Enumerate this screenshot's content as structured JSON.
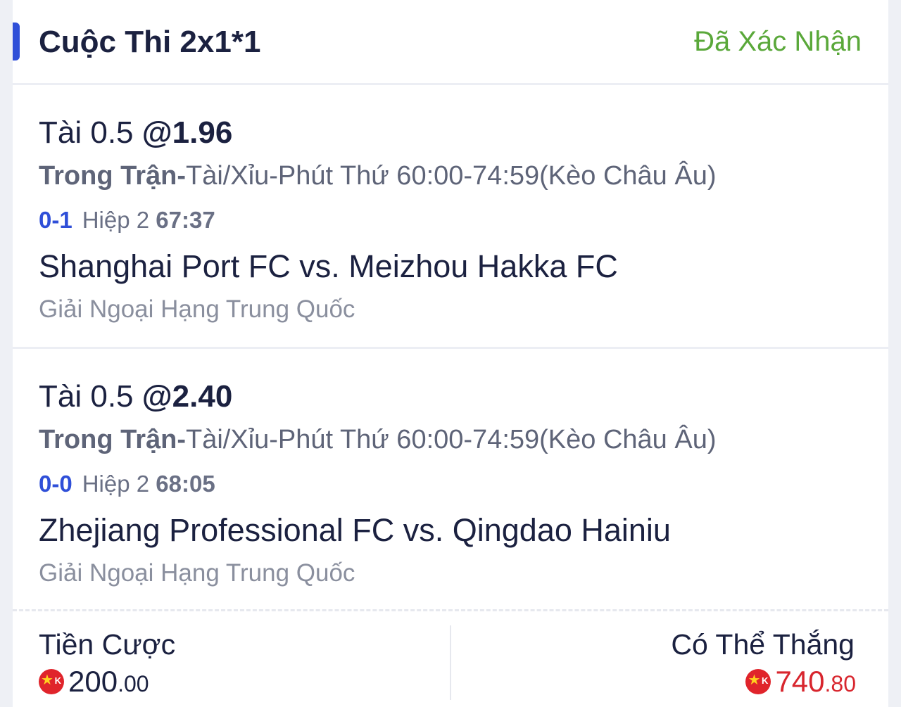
{
  "header": {
    "title": "Cuộc Thi 2x1*1",
    "status": "Đã Xác Nhận",
    "accent_color": "#2f4fd8",
    "status_color": "#5aa83a"
  },
  "bets": [
    {
      "selection": "Tài 0.5 ",
      "odds": "@1.96",
      "market_phase": "Trong Trận-",
      "market_detail": "Tài/Xỉu-Phút Thứ 60:00-74:59(Kèo Châu Âu)",
      "score": "0-1",
      "period": "Hiệp 2 ",
      "match_time": "67:37",
      "match": "Shanghai Port FC vs. Meizhou Hakka FC",
      "league": "Giải Ngoại Hạng Trung Quốc"
    },
    {
      "selection": "Tài 0.5 ",
      "odds": "@2.40",
      "market_phase": "Trong Trận-",
      "market_detail": "Tài/Xỉu-Phút Thứ 60:00-74:59(Kèo Châu Âu)",
      "score": "0-0",
      "period": "Hiệp 2 ",
      "match_time": "68:05",
      "match": "Zhejiang Professional FC vs. Qingdao Hainiu",
      "league": "Giải Ngoại Hạng Trung Quốc"
    }
  ],
  "footer": {
    "stake_label": "Tiền Cược",
    "stake_int": "200",
    "stake_dec": ".00",
    "win_label": "Có Thể Thắng",
    "win_int": "740",
    "win_dec": ".80",
    "currency_icon": "vnd-coin-icon",
    "currency_badge": "K",
    "win_color": "#d8262e"
  }
}
